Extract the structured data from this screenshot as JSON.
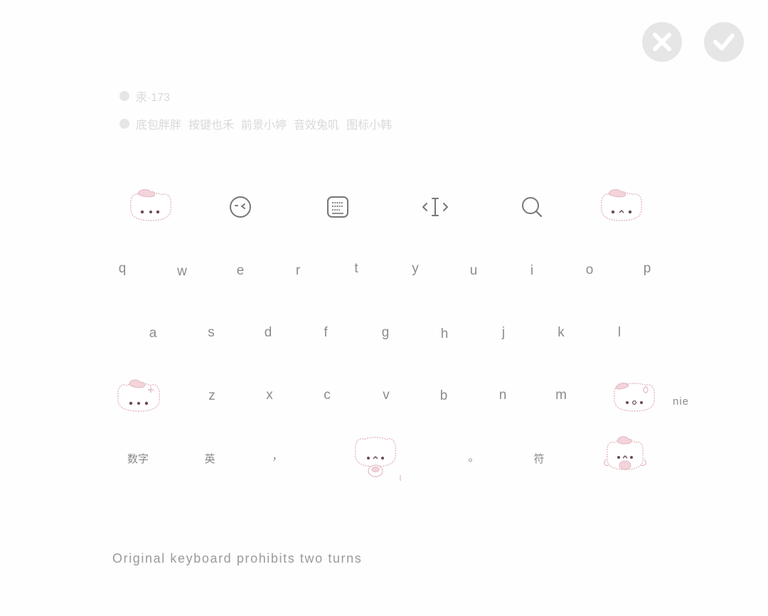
{
  "header": {
    "close_icon": "close-icon",
    "confirm_icon": "check-icon"
  },
  "info": {
    "line1": "汞·173",
    "line2": [
      "底包胖胖",
      "按键也禾",
      "前景小婷",
      "音效兔叽",
      "图标小韩"
    ]
  },
  "toolbar": {
    "items": [
      {
        "name": "cat-sticker",
        "icon": "cat-face-icon"
      },
      {
        "name": "emoji",
        "icon": "emoji-face-icon"
      },
      {
        "name": "clipboard",
        "icon": "clipboard-text-icon"
      },
      {
        "name": "cursor",
        "icon": "text-cursor-icon"
      },
      {
        "name": "search",
        "icon": "search-icon"
      },
      {
        "name": "cat-sticker-right",
        "icon": "cat-face-icon"
      }
    ]
  },
  "keyboard": {
    "row1": [
      "q",
      "w",
      "e",
      "r",
      "t",
      "y",
      "u",
      "i",
      "o",
      "p"
    ],
    "row2": [
      "a",
      "s",
      "d",
      "f",
      "g",
      "h",
      "j",
      "k",
      "l"
    ],
    "row3": [
      "z",
      "x",
      "c",
      "v",
      "b",
      "n",
      "m"
    ],
    "row3_label": "nie",
    "row4": {
      "numbers": "数字",
      "english": "英",
      "comma": "，",
      "period": "。",
      "symbols": "符"
    }
  },
  "footer": {
    "note": "Original keyboard prohibits two turns"
  },
  "colors": {
    "accent_pink": "#e5b9c2",
    "text_gray": "#8c8c8c",
    "button_gray": "#e6e6e6"
  }
}
